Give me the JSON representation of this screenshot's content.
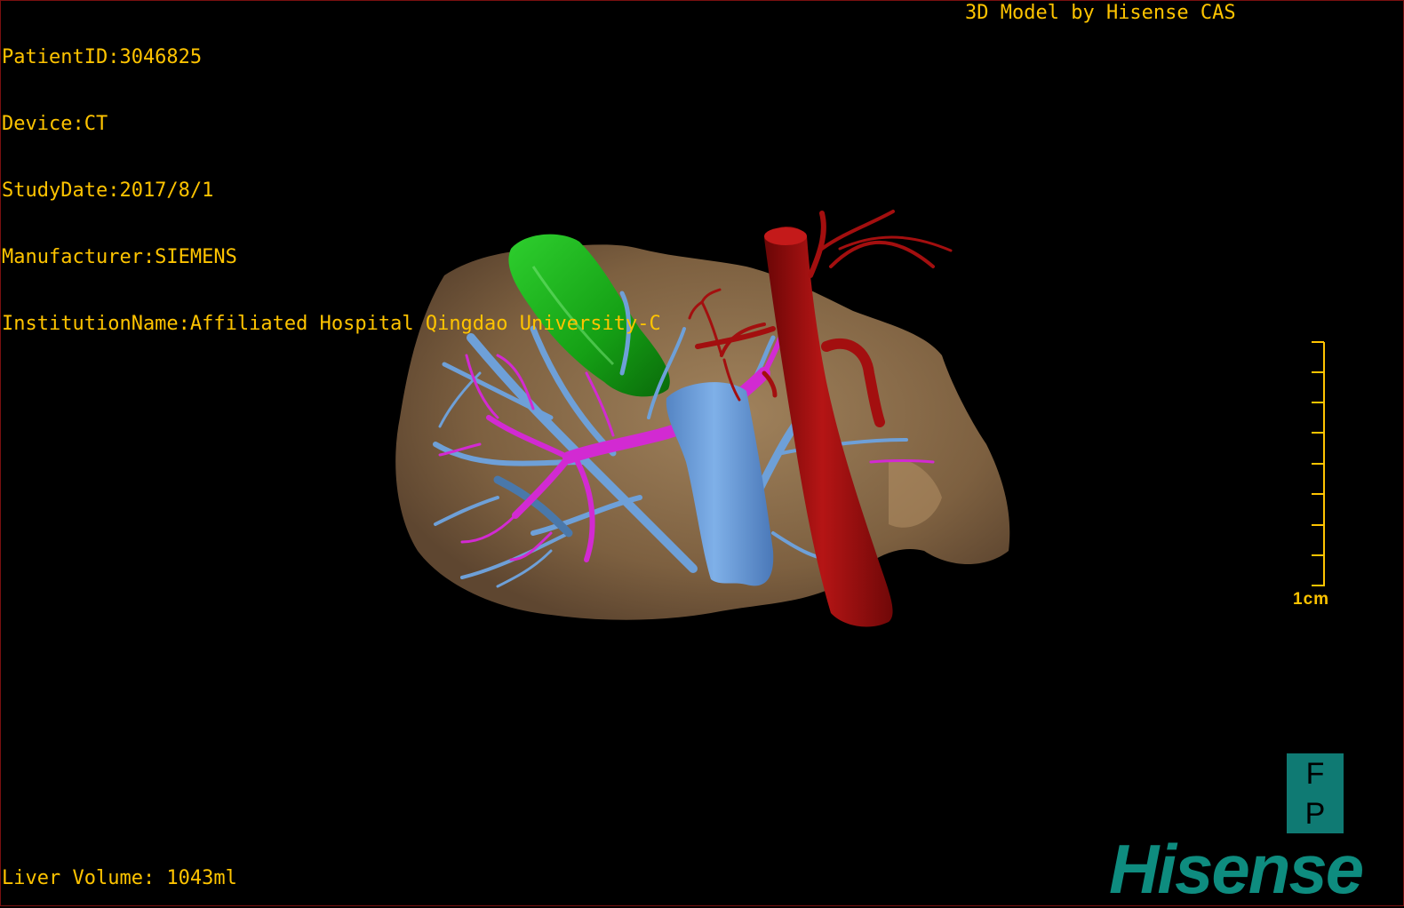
{
  "overlay": {
    "patient_id": "PatientID:3046825",
    "device": "Device:CT",
    "study_date": "StudyDate:2017/8/1",
    "manufacturer": "Manufacturer:SIEMENS",
    "institution": "InstitutionName:Affiliated Hospital Qingdao University-C",
    "model_credit": "3D Model by Hisense CAS",
    "liver_volume": "Liver Volume: 1043ml"
  },
  "scale_bar": {
    "label": "1cm",
    "color": "#ffc400"
  },
  "orientation_cube": {
    "top": "F",
    "bottom": "P",
    "color": "#0f7a73"
  },
  "logo": {
    "text": "Hisense",
    "color": "#0e8c7f"
  },
  "structures": {
    "liver": {
      "color": "#8a6a45"
    },
    "gallbladder": {
      "color": "#1aa51a"
    },
    "hepatic_veins": {
      "color": "#6ea0d8"
    },
    "portal_vein": {
      "color": "#d22ad2"
    },
    "aorta": {
      "color": "#a30f0f"
    }
  }
}
